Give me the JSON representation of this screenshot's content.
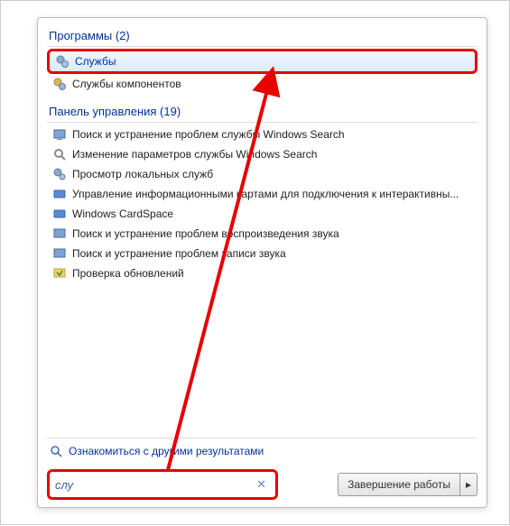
{
  "sections": {
    "programs": {
      "title": "Программы (2)"
    },
    "controlPanel": {
      "title": "Панель управления (19)"
    }
  },
  "programs": [
    {
      "label": "Службы"
    },
    {
      "label": "Службы компонентов"
    }
  ],
  "controlPanel": [
    {
      "label": "Поиск и устранение проблем службы Windows Search"
    },
    {
      "label": "Изменение параметров службы Windows Search"
    },
    {
      "label": "Просмотр локальных служб"
    },
    {
      "label": "Управление информационными картами для подключения к интерактивны..."
    },
    {
      "label": "Windows CardSpace"
    },
    {
      "label": "Поиск и устранение проблем воспроизведения звука"
    },
    {
      "label": "Поиск и устранение проблем записи звука"
    },
    {
      "label": "Проверка обновлений"
    }
  ],
  "moreResults": "Ознакомиться с другими результатами",
  "search": {
    "value": "слу"
  },
  "shutdown": {
    "label": "Завершение работы"
  },
  "colors": {
    "highlight": "#e60000",
    "link": "#003399"
  }
}
